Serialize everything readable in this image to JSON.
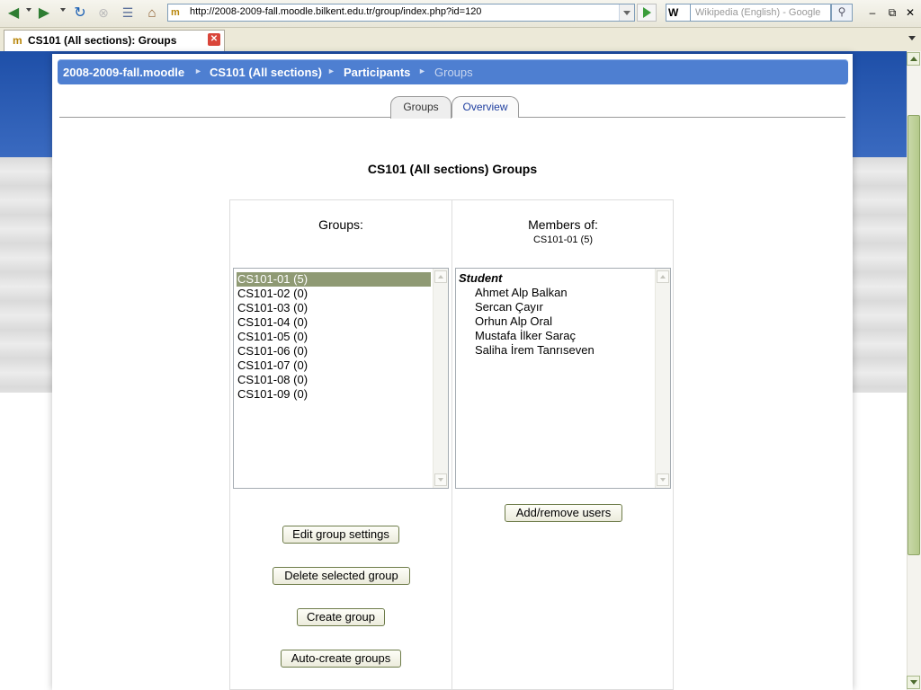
{
  "browser": {
    "url": "http://2008-2009-fall.moodle.bilkent.edu.tr/group/index.php?id=120",
    "search_placeholder": "Wikipedia (English) - Google",
    "tab_title": "CS101 (All sections): Groups",
    "favicon_glyph": "m",
    "search_engine_glyph": "W",
    "back_icon": "back-arrow-icon",
    "forward_icon": "forward-arrow-icon"
  },
  "breadcrumb": {
    "items": [
      "2008-2009-fall.moodle",
      "CS101 (All sections)",
      "Participants",
      "Groups"
    ],
    "separator": "►"
  },
  "tabs": {
    "groups": "Groups",
    "overview": "Overview"
  },
  "page_title": "CS101 (All sections) Groups",
  "groups_panel": {
    "heading": "Groups:",
    "options": [
      "CS101-01 (5)",
      "CS101-02 (0)",
      "CS101-03 (0)",
      "CS101-04 (0)",
      "CS101-05 (0)",
      "CS101-06 (0)",
      "CS101-07 (0)",
      "CS101-08 (0)",
      "CS101-09 (0)"
    ],
    "selected_index": 0,
    "buttons": {
      "edit": "Edit group settings",
      "delete": "Delete selected group",
      "create": "Create group",
      "auto_create": "Auto-create groups"
    }
  },
  "members_panel": {
    "heading": "Members of:",
    "subheading": "CS101-01 (5)",
    "role": "Student",
    "members": [
      "Ahmet Alp Balkan",
      "Sercan Çayır",
      "Orhun Alp Oral",
      "Mustafa İlker Saraç",
      "Saliha İrem Tanrıseven"
    ],
    "add_remove_button": "Add/remove users"
  },
  "colors": {
    "breadcrumb_bg": "#4e7fd1",
    "header_blue": "#1e4fa8",
    "selected_option": "#8f9a74",
    "button_border": "#6e7c4a"
  }
}
